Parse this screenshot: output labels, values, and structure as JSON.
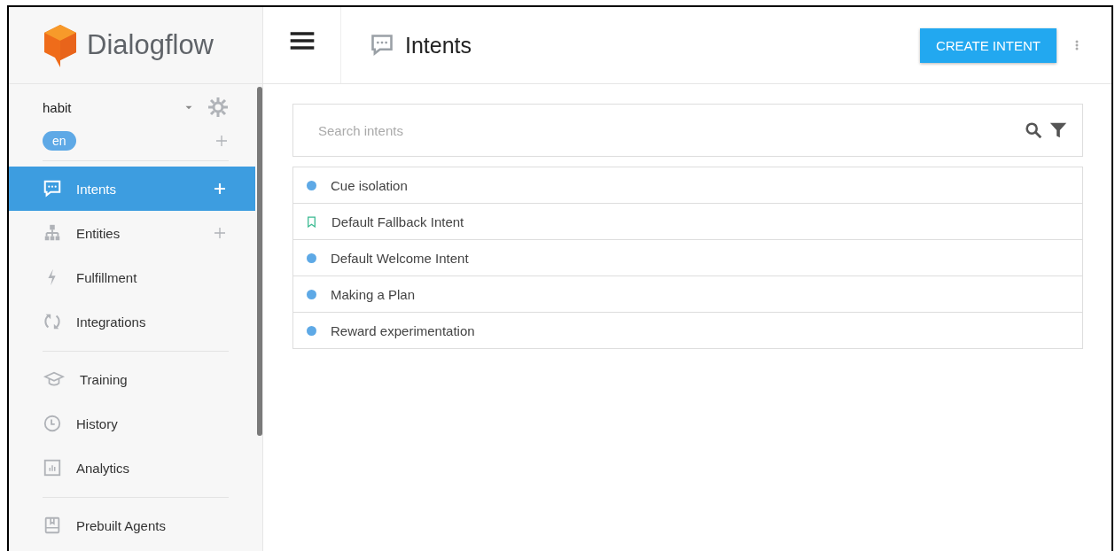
{
  "brand": {
    "name": "Dialogflow"
  },
  "agent": {
    "name": "habit",
    "language": "en"
  },
  "nav_groups": [
    [
      {
        "label": "Intents",
        "selected": true,
        "add": true
      },
      {
        "label": "Entities",
        "selected": false,
        "add": true
      },
      {
        "label": "Fulfillment",
        "selected": false,
        "add": false
      },
      {
        "label": "Integrations",
        "selected": false,
        "add": false
      }
    ],
    [
      {
        "label": "Training",
        "selected": false,
        "add": false
      },
      {
        "label": "History",
        "selected": false,
        "add": false
      },
      {
        "label": "Analytics",
        "selected": false,
        "add": false
      }
    ],
    [
      {
        "label": "Prebuilt Agents",
        "selected": false,
        "add": false
      }
    ]
  ],
  "header": {
    "title": "Intents",
    "button": "CREATE INTENT"
  },
  "search": {
    "placeholder": "Search intents"
  },
  "intents": [
    {
      "name": "Cue isolation",
      "kind": "normal"
    },
    {
      "name": "Default Fallback Intent",
      "kind": "fallback"
    },
    {
      "name": "Default Welcome Intent",
      "kind": "normal"
    },
    {
      "name": "Making a Plan",
      "kind": "normal"
    },
    {
      "name": "Reward experimentation",
      "kind": "normal"
    }
  ]
}
